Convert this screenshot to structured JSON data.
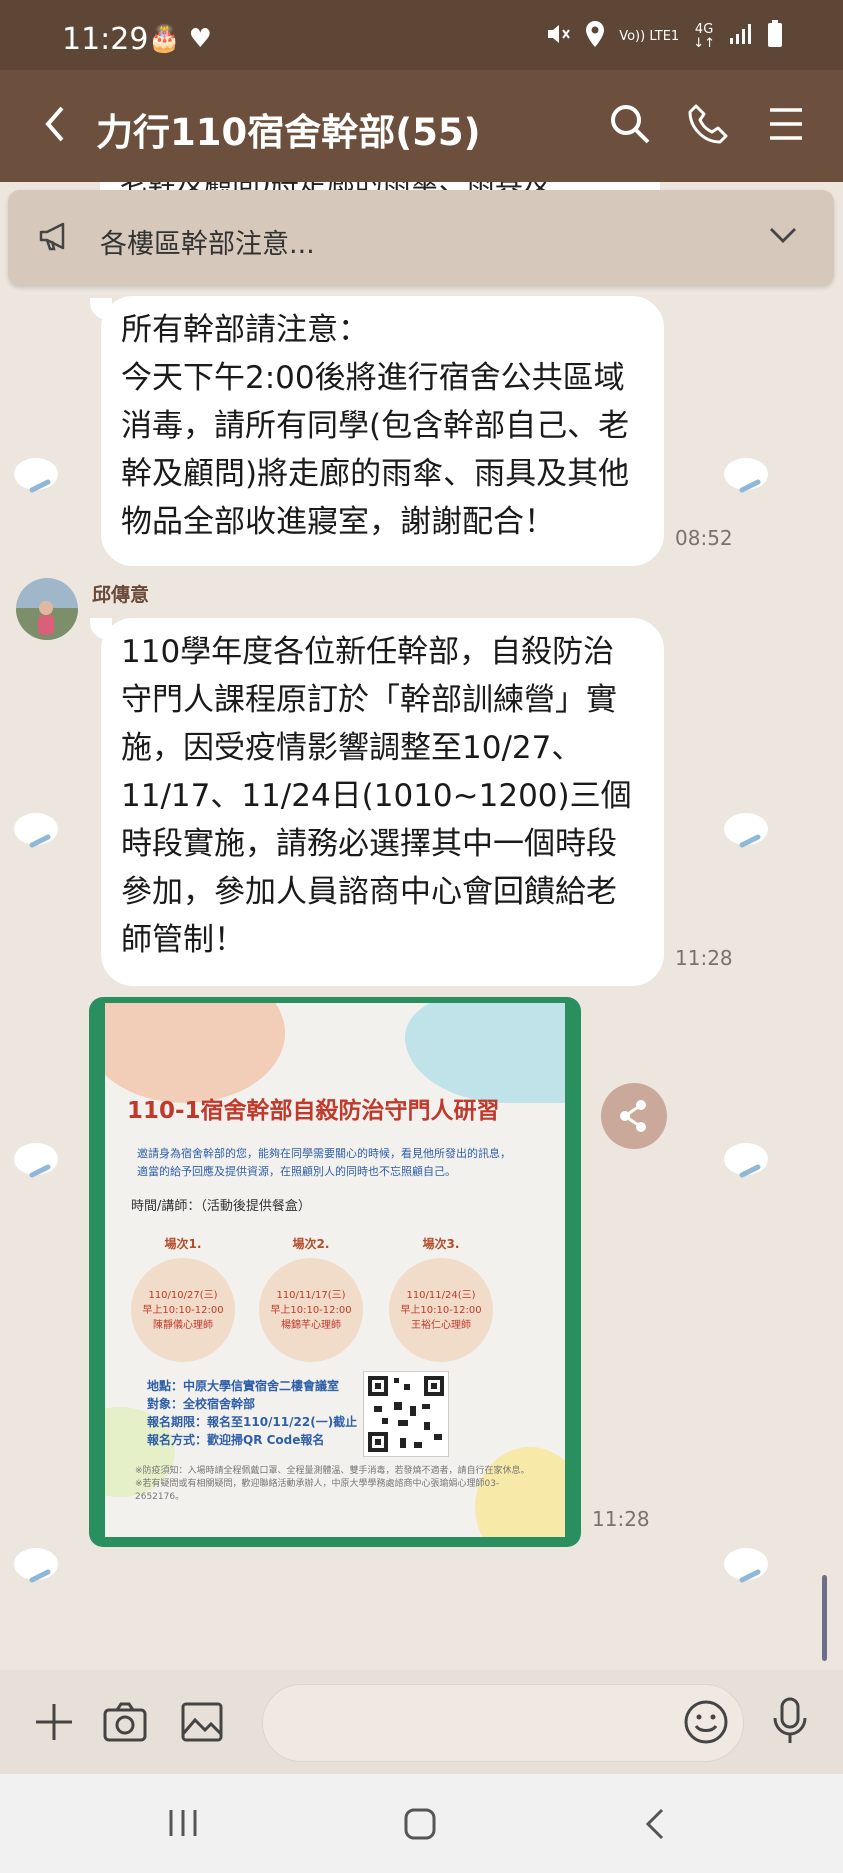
{
  "status_bar": {
    "time": "11:29",
    "time_icons": "🎂 ♥",
    "volte": "Vo)) LTE1",
    "network": "4G",
    "network_arrows": "↓↑"
  },
  "header": {
    "title": "力行110宿舍幹部(55)"
  },
  "peek_text": "老幹及顧問)將走廊的雨傘、雨具及",
  "announcement": {
    "text": "各樓區幹部注意..."
  },
  "messages": [
    {
      "text": "所有幹部請注意：\n今天下午2:00後將進行宿舍公共區域消毒，請所有同學(包含幹部自己、老幹及顧問)將走廊的雨傘、雨具及其他物品全部收進寢室，謝謝配合！",
      "time": "08:52"
    },
    {
      "sender": "邱傳意",
      "text": "110學年度各位新任幹部，自殺防治守門人課程原訂於「幹部訓練營」實施，因受疫情影響調整至10/27、11/17、11/24日(1010~1200)三個時段實施，請務必選擇其中一個時段參加，參加人員諮商中心會回饋給老師管制！",
      "time": "11:28"
    },
    {
      "type": "image",
      "time": "11:28"
    }
  ],
  "poster": {
    "title": "110-1宿舍幹部自殺防治守門人研習",
    "intro": "邀請身為宿舍幹部的您，能夠在同學需要關心的時候，看見他所發出的訊息，適當的給予回應及提供資源，在照顧別人的同時也不忘照顧自己。",
    "time_label": "時間/講師：（活動後提供餐盒）",
    "sessions": [
      {
        "label": "場次1.",
        "date": "110/10/27(三)",
        "time": "早上10:10-12:00",
        "speaker": "陳靜儀心理師"
      },
      {
        "label": "場次2.",
        "date": "110/11/17(三)",
        "time": "早上10:10-12:00",
        "speaker": "楊錦芊心理師"
      },
      {
        "label": "場次3.",
        "date": "110/11/24(三)",
        "time": "早上10:10-12:00",
        "speaker": "王裕仁心理師"
      }
    ],
    "location": "地點：中原大學信實宿舍二樓會議室",
    "audience": "對象：全校宿舍幹部",
    "deadline": "報名期限：報名至110/11/22(一)截止",
    "method": "報名方式：歡迎掃QR Code報名",
    "notice": "※防疫須知：入場時請全程佩戴口罩、全程量測體溫、雙手消毒，若發燒不適者，請自行在家休息。※若有疑問或有相關疑問，歡迎聯絡活動承辦人，中原大學學務處諮商中心張瑜娟心理師03-2652176。"
  },
  "colors": {
    "status_bar": "#5e4637",
    "header": "#6c4f3d",
    "chat_bg": "#ece6df",
    "announcement_bg": "#d6c9bc",
    "bubble": "#ffffff",
    "poster_frame": "#2a8f5f"
  }
}
